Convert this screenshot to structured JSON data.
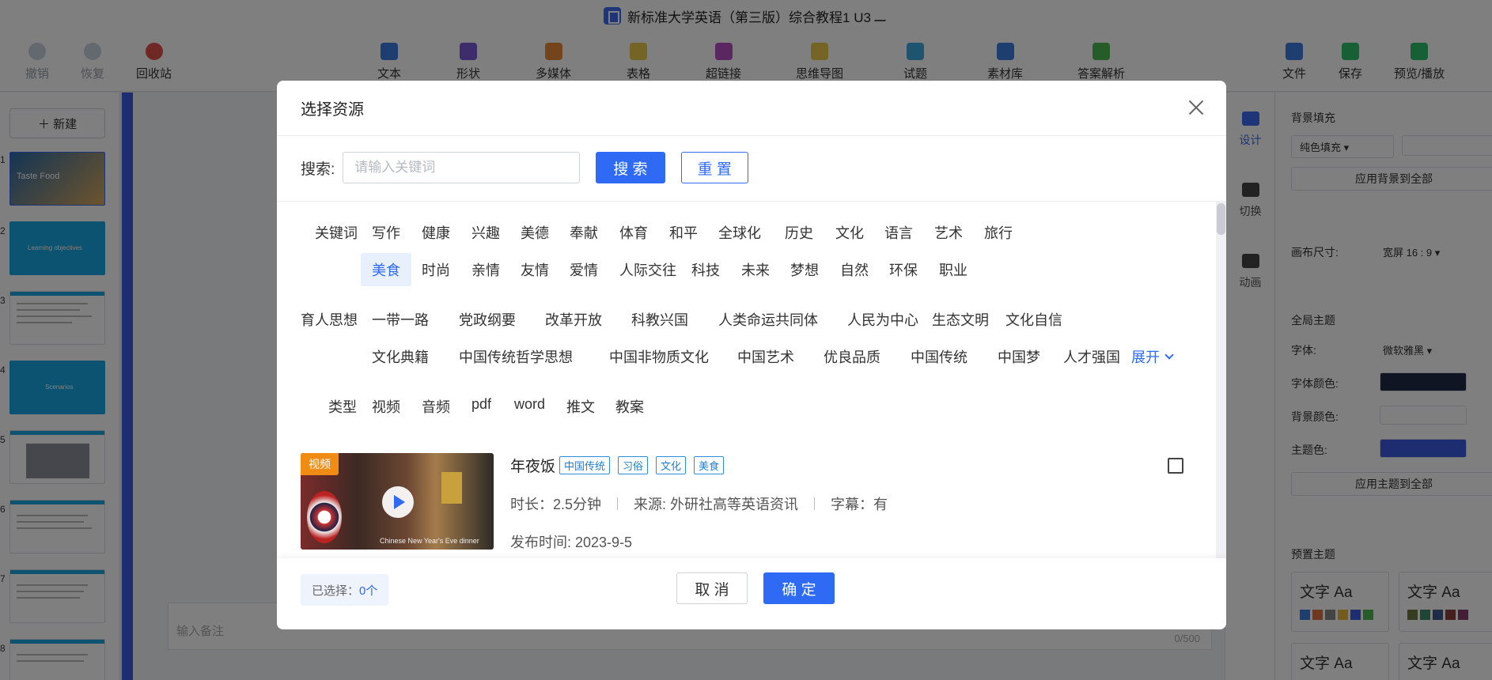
{
  "app": {
    "doc_title": "新标准大学英语（第三版）综合教程1 U3",
    "toolbar": {
      "left": [
        {
          "name": "undo",
          "label": "撤销",
          "icon": "undo-icon",
          "disabled": true
        },
        {
          "name": "redo",
          "label": "恢复",
          "icon": "redo-icon",
          "disabled": true
        },
        {
          "name": "recycle",
          "label": "回收站",
          "icon": "trash-icon",
          "disabled": false
        }
      ],
      "center": [
        {
          "name": "text",
          "label": "文本",
          "icon": "text-icon"
        },
        {
          "name": "shape",
          "label": "形状",
          "icon": "shape-icon"
        },
        {
          "name": "media",
          "label": "多媒体",
          "icon": "media-icon"
        },
        {
          "name": "table",
          "label": "表格",
          "icon": "table-icon"
        },
        {
          "name": "hyperlink",
          "label": "超链接",
          "icon": "link-icon"
        },
        {
          "name": "mindmap",
          "label": "思维导图",
          "icon": "mindmap-icon"
        },
        {
          "name": "quiz",
          "label": "试题",
          "icon": "quiz-icon"
        },
        {
          "name": "library",
          "label": "素材库",
          "icon": "library-icon"
        },
        {
          "name": "answers",
          "label": "答案解析",
          "icon": "answers-icon"
        }
      ],
      "right": [
        {
          "name": "file",
          "label": "文件",
          "icon": "file-icon"
        },
        {
          "name": "save",
          "label": "保存",
          "icon": "save-icon"
        },
        {
          "name": "preview",
          "label": "预览/播放",
          "icon": "play-icon"
        }
      ]
    },
    "thumbnails": {
      "new_label": "新建",
      "slides": [
        {
          "num": "1",
          "text": "Taste Food"
        },
        {
          "num": "2",
          "text": "Learning objectives"
        },
        {
          "num": "3",
          "text": ""
        },
        {
          "num": "4",
          "text": "Scenarios"
        },
        {
          "num": "5",
          "text": ""
        },
        {
          "num": "6",
          "text": ""
        },
        {
          "num": "7",
          "text": ""
        },
        {
          "num": "8",
          "text": ""
        }
      ]
    },
    "notes": {
      "placeholder": "输入备注",
      "count": "0/500"
    },
    "side_tabs": [
      {
        "label": "设计",
        "active": true
      },
      {
        "label": "切换",
        "active": false
      },
      {
        "label": "动画",
        "active": false
      }
    ],
    "properties": {
      "bg_fill_label": "背景填充",
      "bg_fill_value": "纯色填充",
      "apply_bg_all": "应用背景到全部",
      "canvas_size_label": "画布尺寸:",
      "canvas_size_value": "宽屏 16 : 9",
      "global_theme_label": "全局主题",
      "font_label": "字体:",
      "font_value": "微软雅黑",
      "font_color_label": "字体颜色:",
      "font_color": "#1f2a44",
      "bg_color_label": "背景颜色:",
      "theme_color_label": "主题色:",
      "theme_color": "#3c5ae0",
      "apply_theme_all": "应用主题到全部",
      "preset_theme_label": "预置主题",
      "preset_card_text": "文字 Aa"
    }
  },
  "modal": {
    "title": "选择资源",
    "search": {
      "label": "搜索:",
      "placeholder": "请输入关键词",
      "search_button": "搜 索",
      "reset_button": "重 置"
    },
    "keywords": {
      "label": "关键词",
      "row1": [
        "写作",
        "健康",
        "兴趣",
        "美德",
        "奉献",
        "体育",
        "和平",
        "全球化",
        "历史",
        "文化",
        "语言",
        "艺术",
        "旅行"
      ],
      "row2": [
        "美食",
        "时尚",
        "亲情",
        "友情",
        "爱情",
        "人际交往",
        "科技",
        "未来",
        "梦想",
        "自然",
        "环保",
        "职业"
      ],
      "selected": "美食"
    },
    "ideology": {
      "label": "育人思想",
      "row1": [
        "一带一路",
        "党政纲要",
        "改革开放",
        "科教兴国",
        "人类命运共同体",
        "人民为中心",
        "生态文明",
        "文化自信"
      ],
      "row2": [
        "文化典籍",
        "中国传统哲学思想",
        "中国非物质文化",
        "中国艺术",
        "优良品质",
        "中国传统",
        "中国梦",
        "人才强国"
      ],
      "expand_label": "展开"
    },
    "types": {
      "label": "类型",
      "options": [
        "视频",
        "音频",
        "pdf",
        "word",
        "推文",
        "教案"
      ]
    },
    "results": [
      {
        "badge": "视频",
        "title": "年夜饭",
        "tags": [
          "中国传统",
          "习俗",
          "文化",
          "美食"
        ],
        "duration": "时长：2.5分钟",
        "source": "来源: 外研社高等英语资讯",
        "subtitle": "字幕：有",
        "date": "发布时间: 2023-9-5",
        "caption": "Chinese New Year's Eve dinner"
      }
    ],
    "footer": {
      "selected_prefix": "已选择：",
      "selected_count": "0个",
      "cancel_button": "取 消",
      "ok_button": "确 定"
    }
  }
}
